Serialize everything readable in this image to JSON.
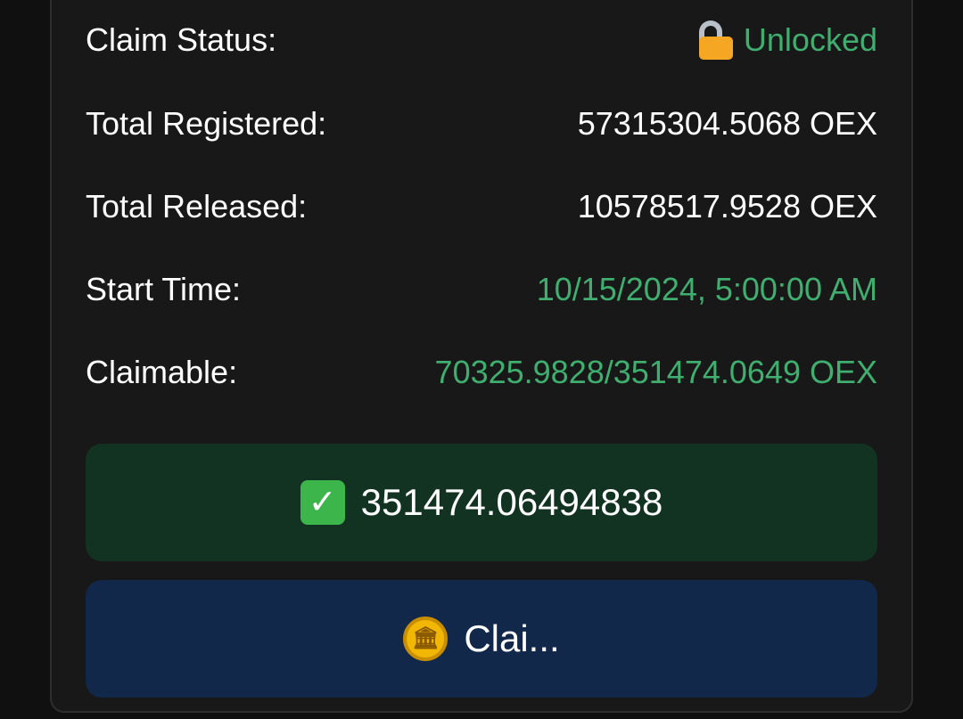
{
  "rows": {
    "claim_status": {
      "label": "Claim Status:",
      "value": "Unlocked",
      "icon": "unlocked-lock-icon"
    },
    "total_registered": {
      "label": "Total Registered:",
      "value": "57315304.5068 OEX"
    },
    "total_released": {
      "label": "Total Released:",
      "value": "10578517.9528 OEX"
    },
    "start_time": {
      "label": "Start Time:",
      "value": "10/15/2024, 5:00:00 AM"
    },
    "claimable": {
      "label": "Claimable:",
      "value": "70325.9828/351474.0649 OEX"
    }
  },
  "buttons": {
    "amount": {
      "label": "351474.06494838",
      "icon": "check-mark-icon"
    },
    "claim": {
      "label": "Clai...",
      "icon": "coin-icon"
    }
  },
  "colors": {
    "background": "#181818",
    "accent_green": "#3fae6f",
    "amount_button_bg": "#133322",
    "claim_button_bg": "#12284a"
  }
}
